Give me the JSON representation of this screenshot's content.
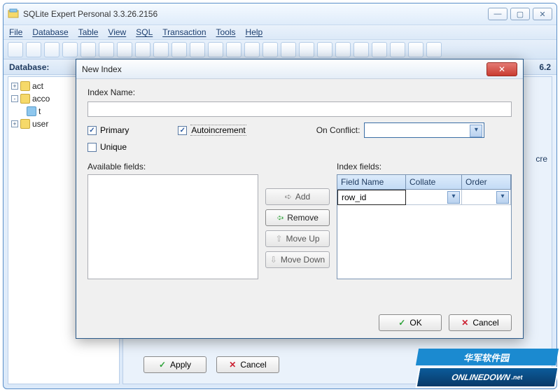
{
  "window": {
    "title": "SQLite Expert Personal 3.3.26.2156"
  },
  "menu": {
    "items": [
      "File",
      "Database",
      "Table",
      "View",
      "SQL",
      "Transaction",
      "Tools",
      "Help"
    ]
  },
  "db_bar": {
    "label": "Database:"
  },
  "db_right": "6.2",
  "tree": {
    "items": [
      {
        "label": "act",
        "expander": "+",
        "kind": "db"
      },
      {
        "label": "acco",
        "expander": "-",
        "kind": "db"
      },
      {
        "label": "t",
        "indent": 1,
        "kind": "table"
      },
      {
        "label": "user",
        "expander": "+",
        "kind": "db"
      }
    ]
  },
  "right_tab": "cre",
  "dialog": {
    "title": "New Index",
    "index_name_label": "Index Name:",
    "index_name_value": "",
    "primary_label": "Primary",
    "primary_checked": true,
    "autoincrement_label": "Autoincrement",
    "autoincrement_checked": true,
    "unique_label": "Unique",
    "unique_checked": false,
    "on_conflict_label": "On Conflict:",
    "on_conflict_value": "",
    "available_label": "Available fields:",
    "index_fields_label": "Index fields:",
    "grid_headers": {
      "field_name": "Field Name",
      "collate": "Collate",
      "order": "Order"
    },
    "grid_rows": [
      {
        "field_name": "row_id",
        "collate": "",
        "order": ""
      }
    ],
    "buttons": {
      "add": "Add",
      "remove": "Remove",
      "move_up": "Move Up",
      "move_down": "Move Down",
      "ok": "OK",
      "cancel": "Cancel"
    }
  },
  "back_footer": {
    "apply": "Apply",
    "cancel": "Cancel"
  },
  "watermark": {
    "line1": "华军软件园",
    "line2": "ONLINEDOWN",
    "suffix": ".net"
  }
}
